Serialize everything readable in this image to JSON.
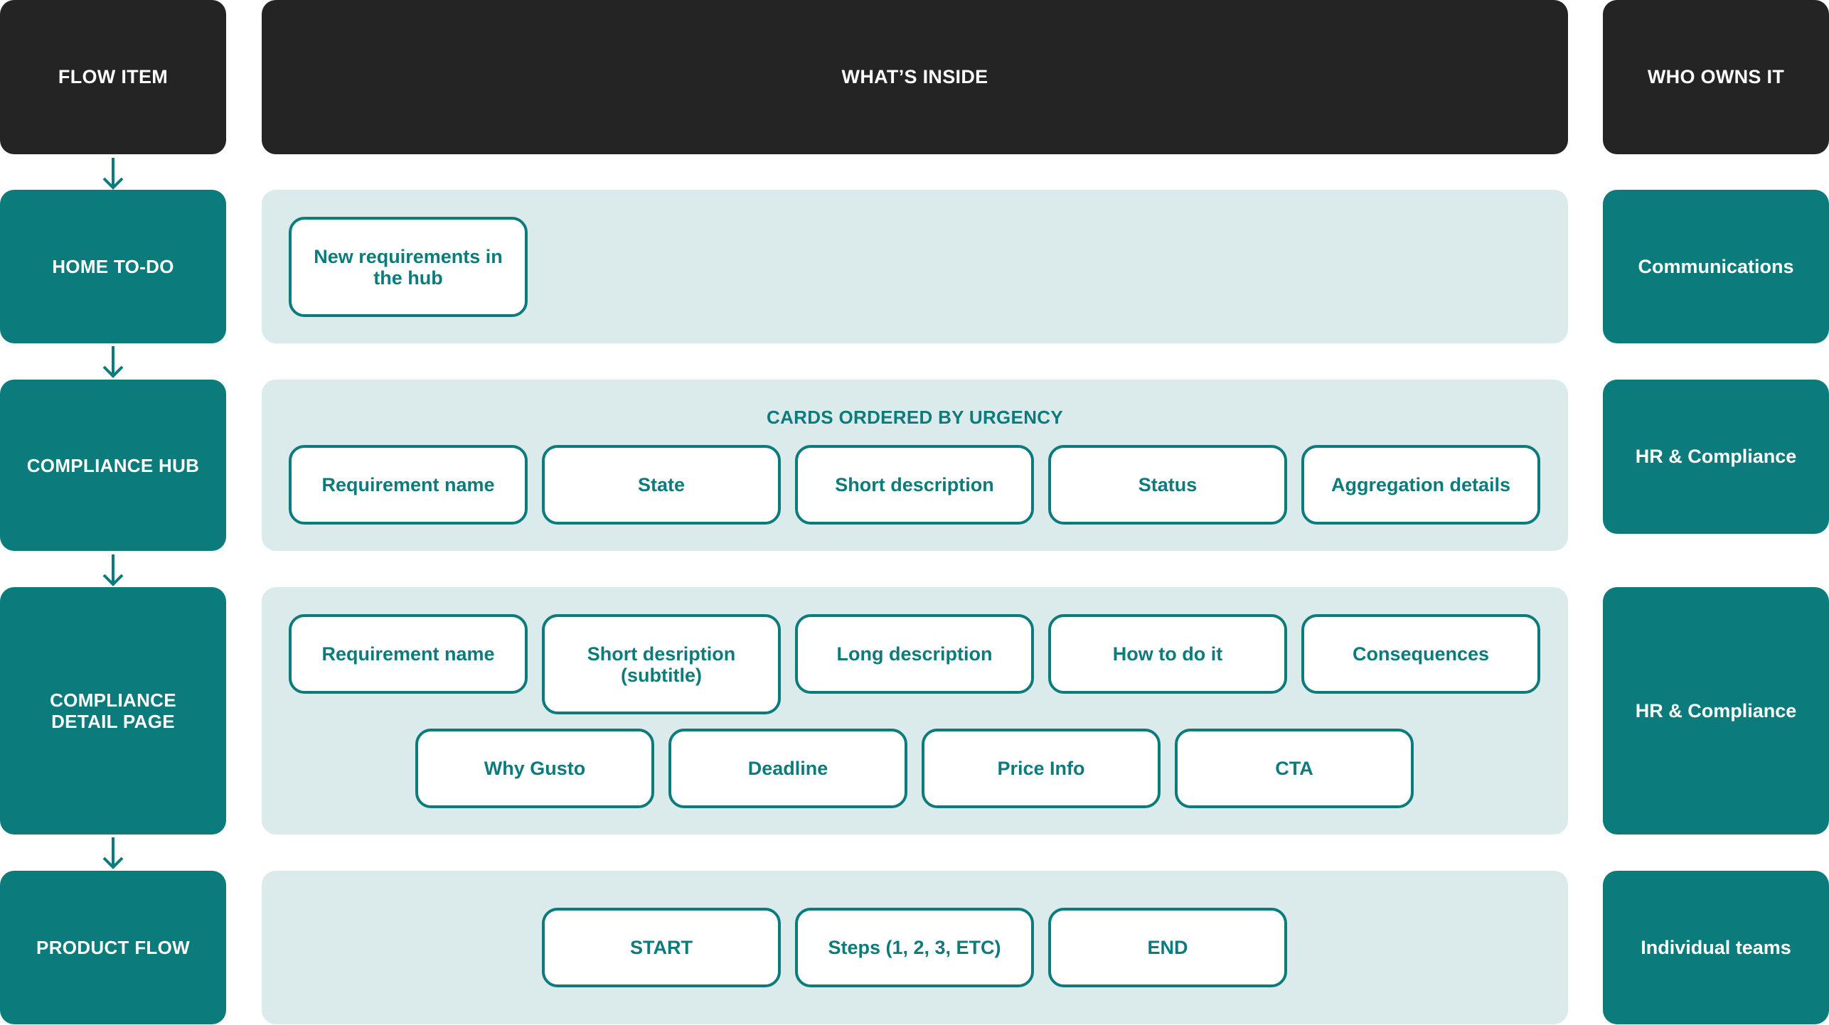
{
  "headers": {
    "flow_item": "FLOW ITEM",
    "whats_inside": "WHAT’S INSIDE",
    "who_owns_it": "WHO OWNS IT"
  },
  "rows": [
    {
      "flow_item": "HOME TO-DO",
      "owner": "Communications",
      "items": [
        "New requirements in the hub"
      ]
    },
    {
      "flow_item": "COMPLIANCE HUB",
      "owner": "HR & Compliance",
      "section_label": "CARDS ORDERED BY URGENCY",
      "items": [
        "Requirement name",
        "State",
        "Short description",
        "Status",
        "Aggregation details"
      ]
    },
    {
      "flow_item": "COMPLIANCE DETAIL PAGE",
      "owner": "HR & Compliance",
      "items": [
        "Requirement name",
        "Short desription (subtitle)",
        "Long description",
        "How to do it",
        "Consequences",
        "Why Gusto",
        "Deadline",
        "Price Info",
        "CTA"
      ]
    },
    {
      "flow_item": "PRODUCT FLOW",
      "owner": "Individual teams",
      "items": [
        "START",
        "Steps (1, 2, 3, ETC)",
        "END"
      ]
    }
  ],
  "colors": {
    "header_bg": "#242424",
    "accent": "#0c7b7b",
    "panel_bg": "#dbeaea",
    "card_bg": "#ffffff"
  },
  "icons": {
    "connector": "arrow-down-icon"
  }
}
